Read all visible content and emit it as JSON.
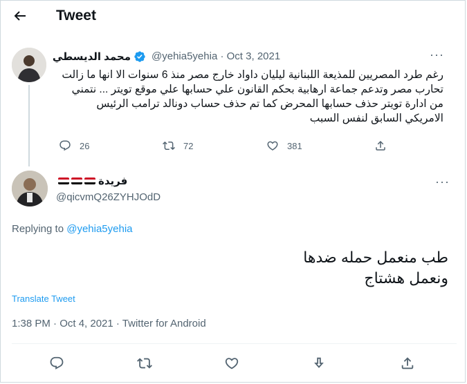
{
  "header": {
    "title": "Tweet"
  },
  "original_tweet": {
    "author_name": "محمد الديسطي",
    "handle": "@yehia5yehia",
    "date": "Oct 3, 2021",
    "text": "رغم طرد المصريين للمذيعة اللبنانية ليليان داواد خارج مصر منذ 6 سنوات الا انها ما زالت تحارب مصر وتدعم جماعة ارهابية بحكم القانون علي حسابها علي موقع تويتر ... نتمني من ادارة تويتر حذف حسابها المحرض كما تم حذف حساب دونالد ترامب الرئيس الامريكي السابق لنفس السبب",
    "replies": "26",
    "retweets": "72",
    "likes": "381"
  },
  "reply_tweet": {
    "author_name": "فريدة",
    "handle": "@qicvmQ26ZYHJOdD",
    "replying_prefix": "Replying to",
    "replying_to": "@yehia5yehia",
    "text_line1": "طب منعمل حمله ضدها",
    "text_line2": "ونعمل هشتاج",
    "translate_label": "Translate Tweet",
    "timestamp": "1:38 PM · Oct 4, 2021 · Twitter for Android"
  },
  "colors": {
    "accent": "#1d9bf0",
    "secondary_text": "#536471",
    "verified": "#1d9bf0"
  },
  "icons": [
    "back-arrow-icon",
    "verified-badge-icon",
    "more-icon",
    "reply-icon",
    "retweet-icon",
    "like-icon",
    "share-icon",
    "downvote-icon"
  ]
}
